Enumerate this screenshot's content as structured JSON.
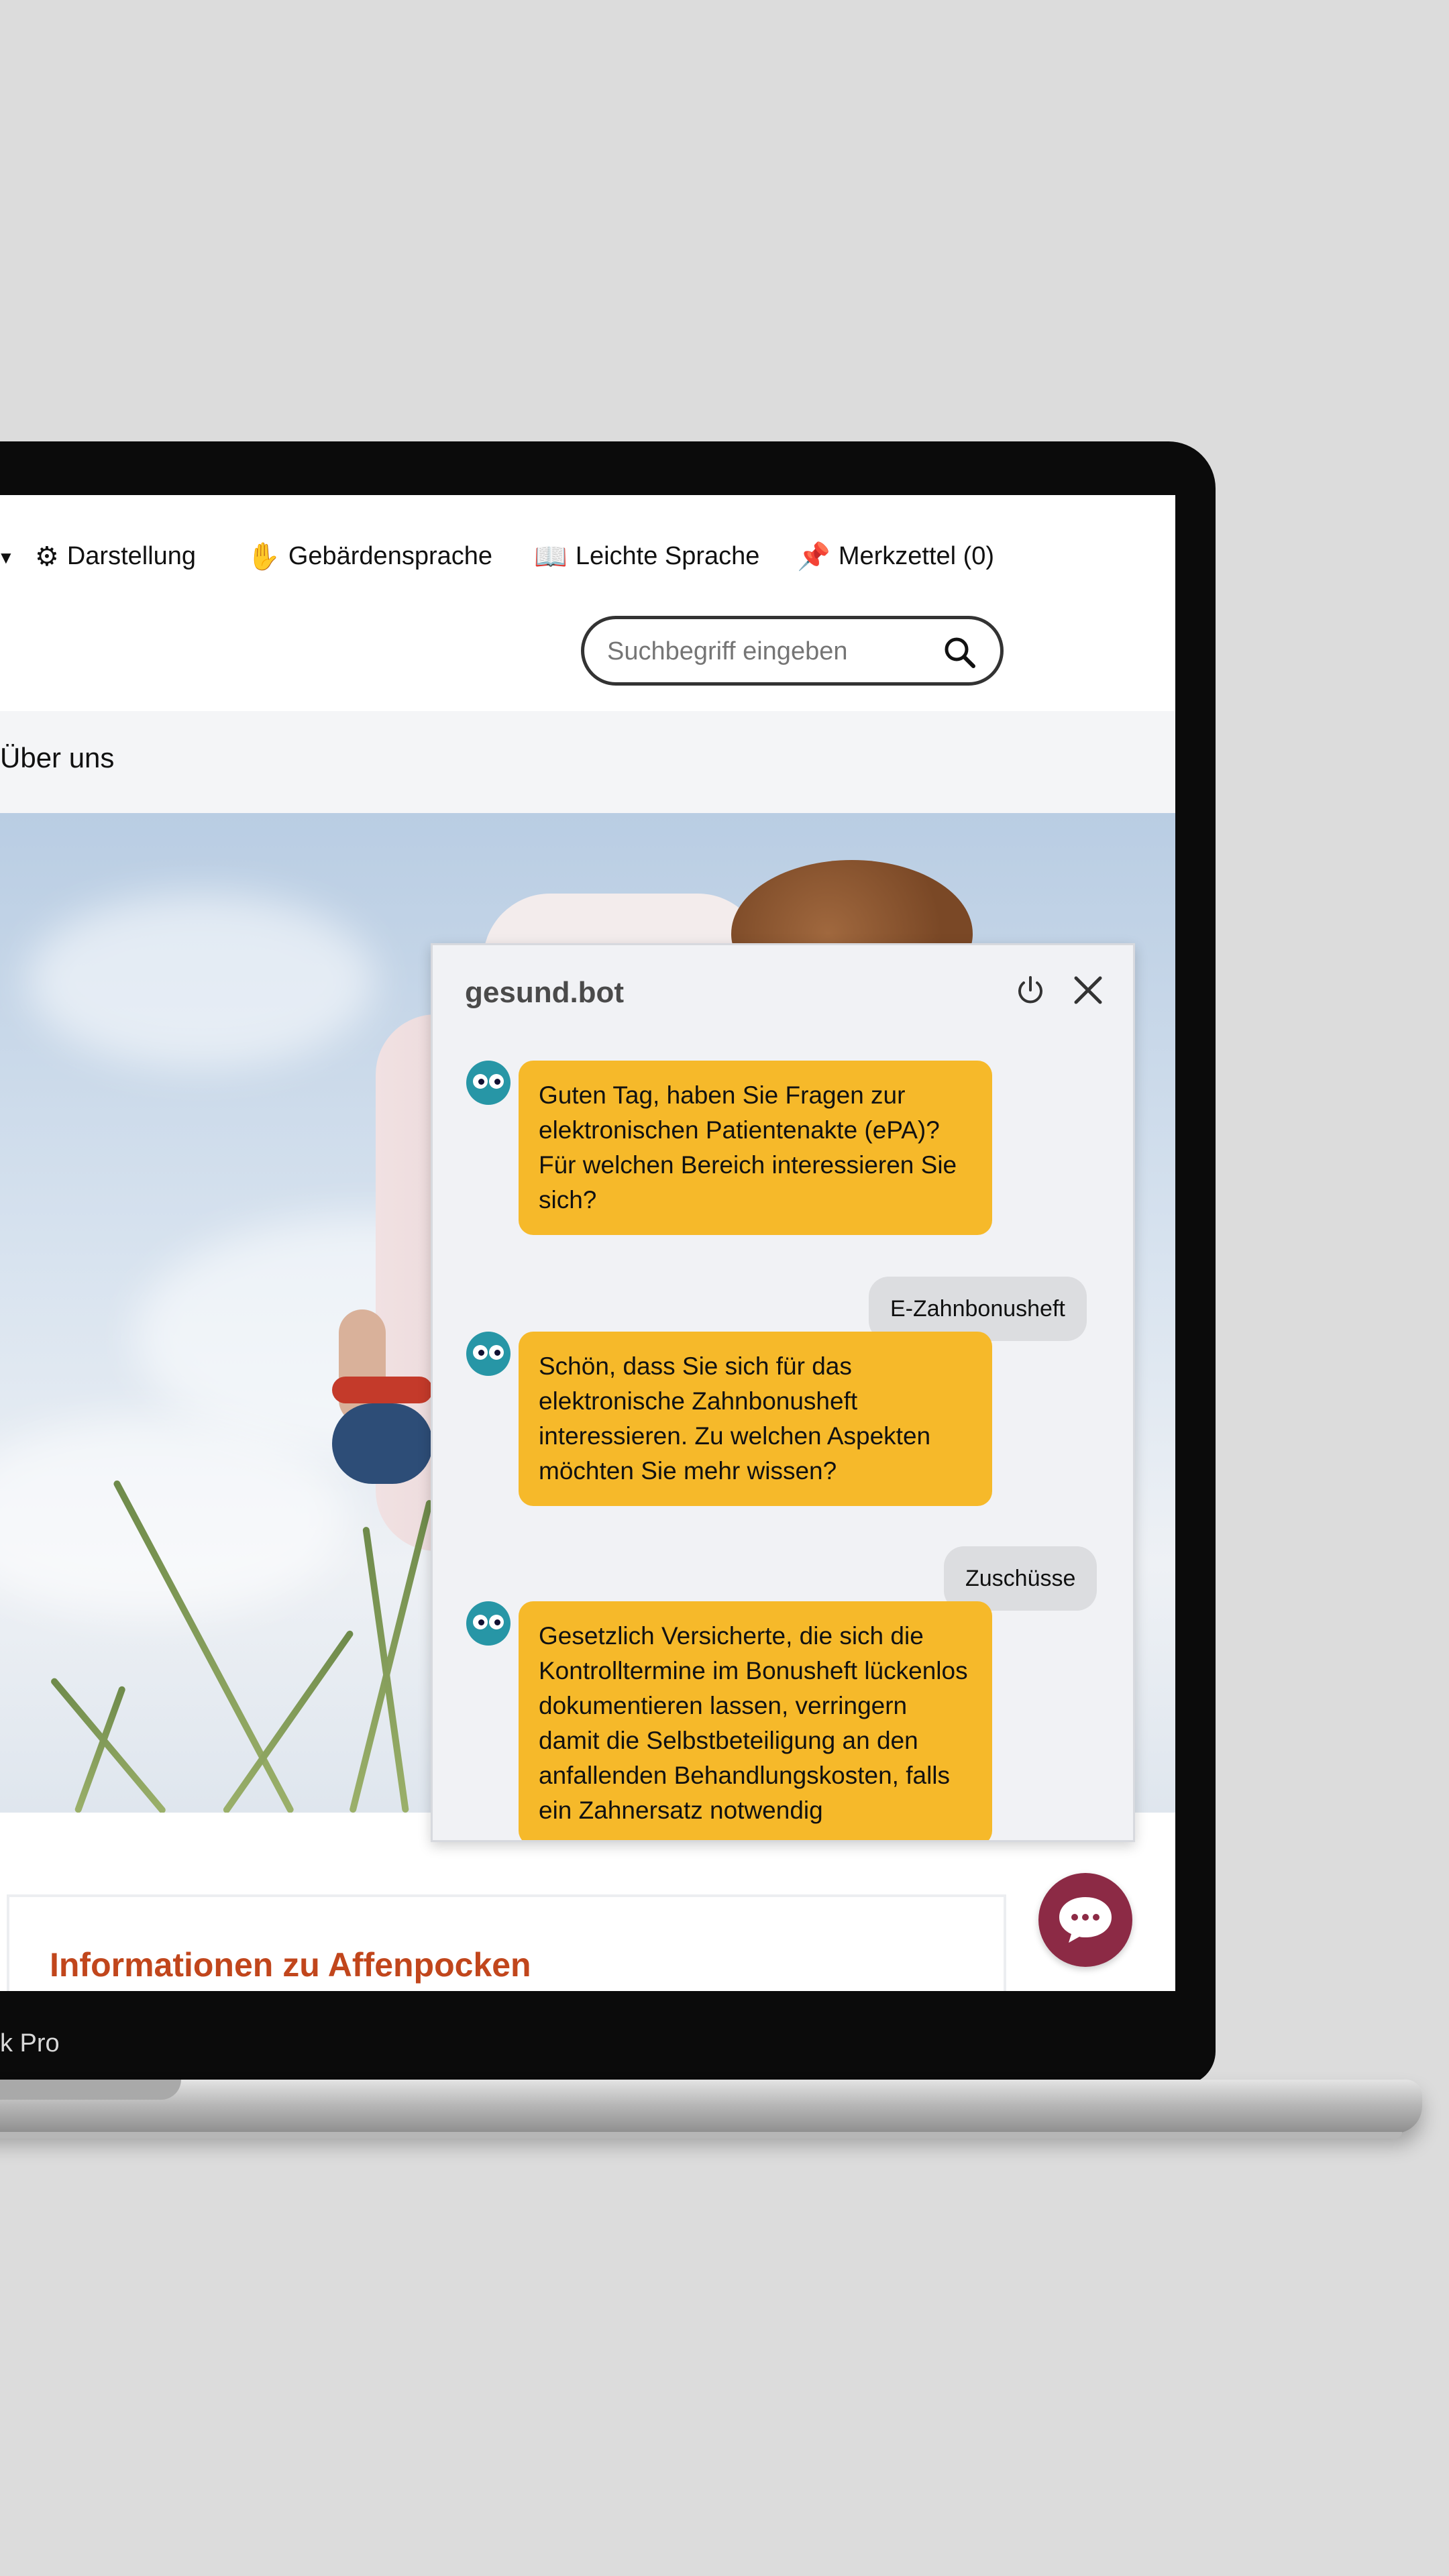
{
  "toolbar": {
    "items": [
      {
        "label": "Darstellung",
        "icon": "gear-icon"
      },
      {
        "label": "Gebärdensprache",
        "icon": "sign-language-icon"
      },
      {
        "label": "Leichte Sprache",
        "icon": "easy-language-icon"
      },
      {
        "label": "Merkzettel (0)",
        "icon": "pin-icon"
      }
    ]
  },
  "search": {
    "placeholder": "Suchbegriff eingeben"
  },
  "nav": {
    "about_label": "Über uns"
  },
  "chatbot": {
    "title": "gesund.bot",
    "messages": [
      {
        "from": "bot",
        "text": "Guten Tag, haben Sie Fragen zur elektronischen Patientenakte (ePA)? Für welchen Bereich interessieren Sie sich?"
      },
      {
        "from": "user",
        "text": "E-Zahnbonusheft"
      },
      {
        "from": "bot",
        "text": "Schön, dass Sie sich für das elektronische Zahnbonusheft interessieren. Zu welchen Aspekten möchten Sie mehr wissen?"
      },
      {
        "from": "user",
        "text": "Zuschüsse"
      },
      {
        "from": "bot",
        "text": "Gesetzlich Versicherte, die sich die Kontrolltermine im Bonusheft lückenlos dokumentieren lassen, verringern damit die Selbstbeteiligung an den anfallenden Behandlungskosten, falls ein Zahnersatz notwendig"
      }
    ]
  },
  "card": {
    "title": "Informationen zu Affenpocken"
  },
  "device": {
    "brand_label": "k Pro"
  },
  "colors": {
    "bot_bubble": "#f6b92a",
    "accent": "#c1461c",
    "fab": "#8c2a45",
    "avatar": "#2796a6"
  }
}
